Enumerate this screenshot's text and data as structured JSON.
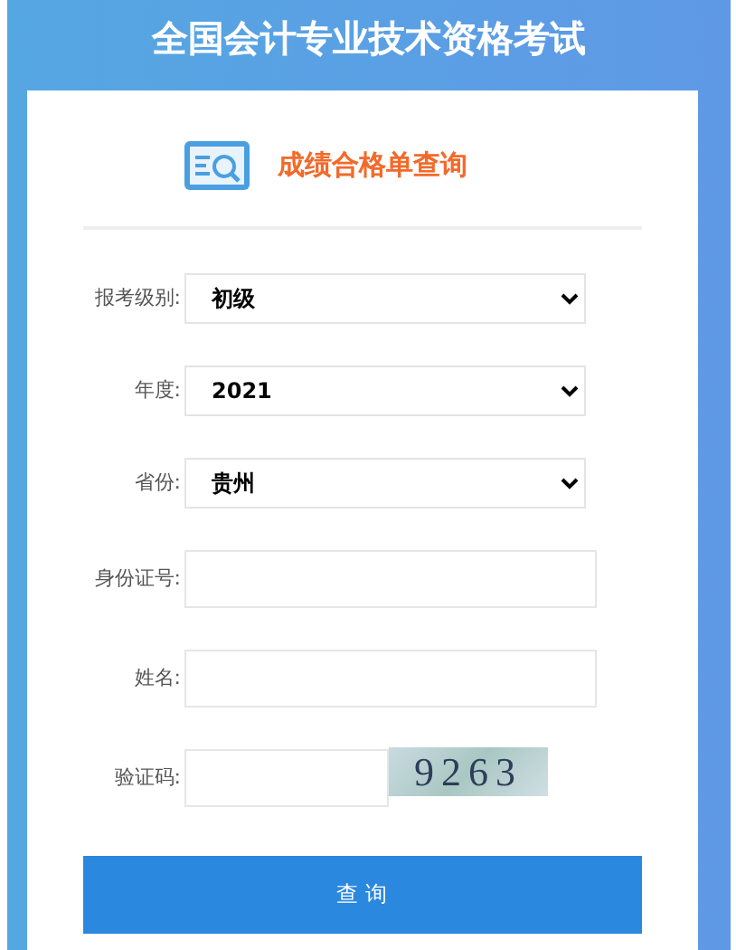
{
  "header": {
    "title": "全国会计专业技术资格考试"
  },
  "card": {
    "heading": "成绩合格单查询"
  },
  "fields": [
    {
      "kind": "select",
      "label": "报考级别:",
      "value": "初级"
    },
    {
      "kind": "select",
      "label": "年度:",
      "value": "2021"
    },
    {
      "kind": "select",
      "label": "省份:",
      "value": "贵州"
    },
    {
      "kind": "input",
      "label": "身份证号:"
    },
    {
      "kind": "input",
      "label": "姓名:"
    },
    {
      "kind": "captcha",
      "label": "验证码:",
      "code": "9263"
    }
  ],
  "submit": "查 询"
}
